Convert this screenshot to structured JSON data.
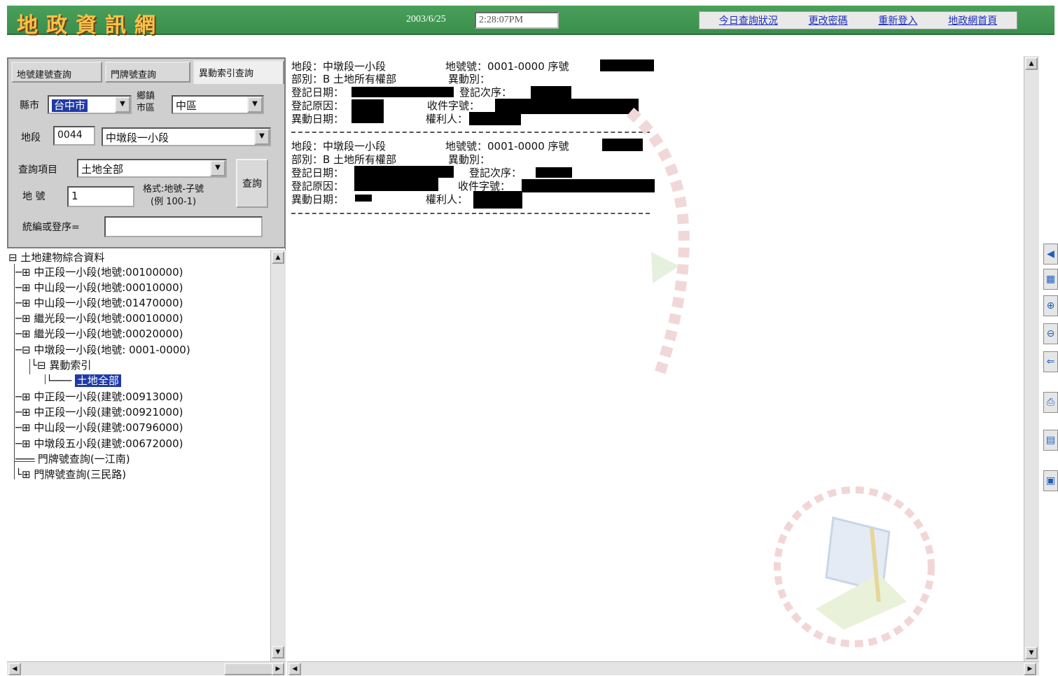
{
  "header": {
    "title": "地政資訊網",
    "date": "2003/6/25",
    "time": "2:28:07PM",
    "links": [
      "今日查詢狀況",
      "更改密碼",
      "重新登入",
      "地政網首頁"
    ]
  },
  "query_panel": {
    "tabs": [
      "地號建號查詢",
      "門牌號查詢",
      "異動索引查詢"
    ],
    "active_tab": 2,
    "city_label": "縣市",
    "city_value": "台中市",
    "district_label_1": "鄉鎮",
    "district_label_2": "市區",
    "district_value": "中區",
    "section_label": "地段",
    "section_code": "0044",
    "section_name": "中墩段一小段",
    "item_label": "查詢項目",
    "item_value": "土地全部",
    "lotno_label": "地 號",
    "lotno_value": "1",
    "format_hint_1": "格式:地號-子號",
    "format_hint_2": "(例 100-1)",
    "query_button": "查詢",
    "compile_label": "統編或登序="
  },
  "tree": {
    "root": "土地建物綜合資料",
    "items": [
      "中正段一小段(地號:00100000)",
      "中山段一小段(地號:00010000)",
      "中山段一小段(地號:01470000)",
      "繼光段一小段(地號:00010000)",
      "繼光段一小段(地號:00020000)",
      "中墩段一小段(地號: 0001-0000)",
      "異動索引",
      "土地全部",
      "中正段一小段(建號:00913000)",
      "中正段一小段(建號:00921000)",
      "中山段一小段(建號:00796000)",
      "中墩段五小段(建號:00672000)",
      "門牌號查詢(一江南)",
      "門牌號查詢(三民路)"
    ]
  },
  "records": [
    {
      "section": "地段：中墩段一小段",
      "lot": "地號號：0001-0000 序號",
      "part": "部別：B 土地所有權部",
      "change_type": "異動別：",
      "reg_date": "登記日期：",
      "reg_seq": "登記次序：",
      "reg_reason": "登記原因：",
      "receipt_no": "收件字號：",
      "change_date": "異動日期：",
      "right_holder": "權利人："
    },
    {
      "section": "地段：中墩段一小段",
      "lot": "地號號：0001-0000 序號",
      "part": "部別：B 土地所有權部",
      "change_type": "異動別：",
      "reg_date": "登記日期：",
      "reg_seq": "登記次序：",
      "reg_reason": "登記原因：",
      "receipt_no": "收件字號：",
      "change_date": "異動日期：",
      "right_holder": "權利人："
    }
  ],
  "icons": {
    "tree_collapse": "minus-box-icon",
    "tree_expand": "plus-box-icon",
    "zoom_in": "zoom-in-icon",
    "zoom_out": "zoom-out-icon",
    "back": "arrow-left-icon",
    "print": "printer-icon"
  },
  "colors": {
    "header_green": "#3a8f4c",
    "title_gold": "#f3c44a",
    "link_blue": "#1d2fb8",
    "selection_blue": "#1f3aa6"
  }
}
